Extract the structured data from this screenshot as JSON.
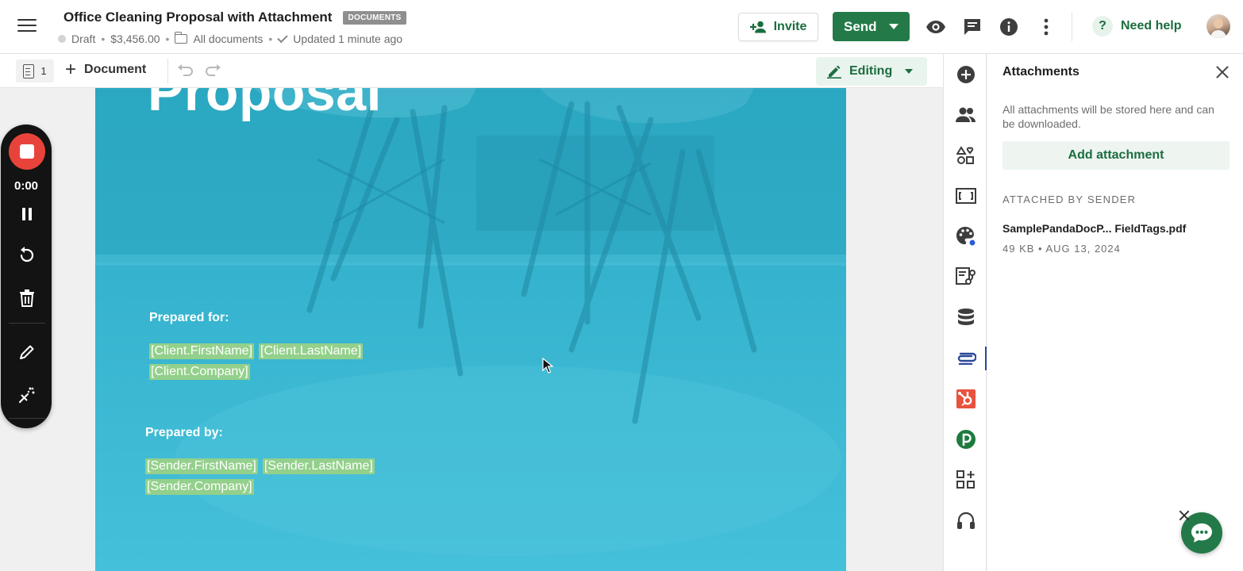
{
  "header": {
    "menu_icon": "hamburger-icon",
    "title": "Office Cleaning Proposal with Attachment",
    "badge": "DOCUMENTS",
    "status": "Draft",
    "amount": "$3,456.00",
    "folder": "All documents",
    "updated": "Updated 1 minute ago",
    "invite_label": "Invite",
    "send_label": "Send",
    "help_label": "Need help",
    "help_glyph": "?",
    "icons": [
      "preview-eye-icon",
      "comments-icon",
      "info-icon",
      "more-vertical-icon"
    ]
  },
  "toolbar": {
    "page_count": "1",
    "add_document_label": "Document",
    "add_glyph": "+",
    "editing_label": "Editing"
  },
  "document": {
    "cover_title": "Proposal",
    "prepared_for_label": "Prepared for:",
    "client_first": "[Client.FirstName]",
    "client_last": "[Client.LastName]",
    "client_company": "[Client.Company]",
    "prepared_by_label": "Prepared by:",
    "sender_first": "[Sender.FirstName]",
    "sender_last": "[Sender.LastName]",
    "sender_company": "[Sender.Company]"
  },
  "recorder": {
    "time": "0:00"
  },
  "rail": {
    "items": [
      "add-icon",
      "recipients-icon",
      "content-blocks-icon",
      "variables-icon",
      "design-palette-icon",
      "workflow-icon",
      "database-icon",
      "attachment-icon",
      "hubspot-icon",
      "pipedrive-icon",
      "apps-icon",
      "support-headset-icon"
    ],
    "active": "attachment-icon"
  },
  "attachments": {
    "title": "Attachments",
    "description": "All attachments will be stored here and can be downloaded.",
    "add_label": "Add attachment",
    "section_label": "ATTACHED BY SENDER",
    "file_name": "SamplePandaDocP... FieldTags.pdf",
    "file_meta": "49 KB • AUG 13, 2024"
  },
  "colors": {
    "brand_green": "#237a48",
    "text_green": "#1b6d3f",
    "cover_blue": "#3cb7d1",
    "field_tag": "#93d08b",
    "record_red": "#e8433a"
  }
}
